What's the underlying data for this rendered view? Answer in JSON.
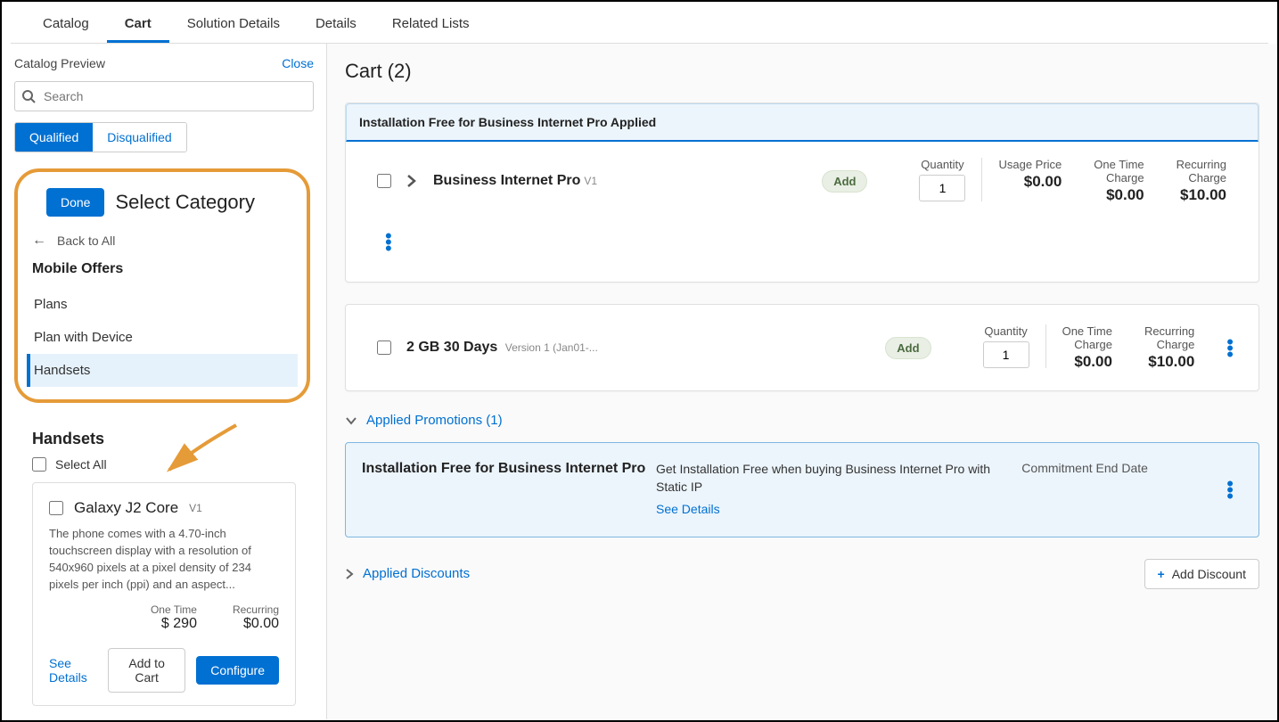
{
  "tabs": {
    "items": [
      "Catalog",
      "Cart",
      "Solution Details",
      "Details",
      "Related Lists"
    ],
    "active": "Cart"
  },
  "sidebar": {
    "title": "Catalog Preview",
    "close": "Close",
    "search_placeholder": "Search",
    "filter": {
      "qualified": "Qualified",
      "disqualified": "Disqualified"
    },
    "category": {
      "done": "Done",
      "title": "Select Category",
      "back": "Back to All",
      "group": "Mobile Offers",
      "items": [
        "Plans",
        "Plan with Device",
        "Handsets"
      ],
      "selected": "Handsets"
    },
    "handsets": {
      "title": "Handsets",
      "select_all": "Select All",
      "product": {
        "name": "Galaxy J2 Core",
        "version": "V1",
        "desc": "The phone comes with a 4.70-inch touchscreen display with a resolution of 540x960 pixels at a pixel density of 234 pixels per inch (ppi) and an aspect...",
        "onetime_label": "One Time",
        "onetime_value": "$ 290",
        "recurring_label": "Recurring",
        "recurring_value": "$0.00",
        "see_details": "See Details",
        "add_to_cart": "Add to Cart",
        "configure": "Configure"
      }
    }
  },
  "cart": {
    "title": "Cart (2)",
    "promo_banner": "Installation Free for Business Internet Pro Applied",
    "add_label": "Add",
    "cols": {
      "qty": "Quantity",
      "usage": "Usage Price",
      "otc": "One Time",
      "otc2": "Charge",
      "rec": "Recurring",
      "rec2": "Charge"
    },
    "items": [
      {
        "name": "Business Internet Pro",
        "version": "V1",
        "qty": "1",
        "usage": "$0.00",
        "otc": "$0.00",
        "rec": "$10.00",
        "show_usage": true,
        "show_chevron": true
      },
      {
        "name": "2 GB 30 Days",
        "version": "Version 1 (Jan01-...",
        "qty": "1",
        "usage": "",
        "otc": "$0.00",
        "rec": "$10.00",
        "show_usage": false,
        "show_chevron": false
      }
    ],
    "applied_promotions": "Applied Promotions (1)",
    "promo": {
      "title": "Installation Free for Business Internet Pro",
      "desc": "Get Installation Free when buying Business Internet Pro with Static IP",
      "see_details": "See Details",
      "commitment": "Commitment End Date"
    },
    "applied_discounts": "Applied Discounts",
    "add_discount": "Add Discount"
  }
}
